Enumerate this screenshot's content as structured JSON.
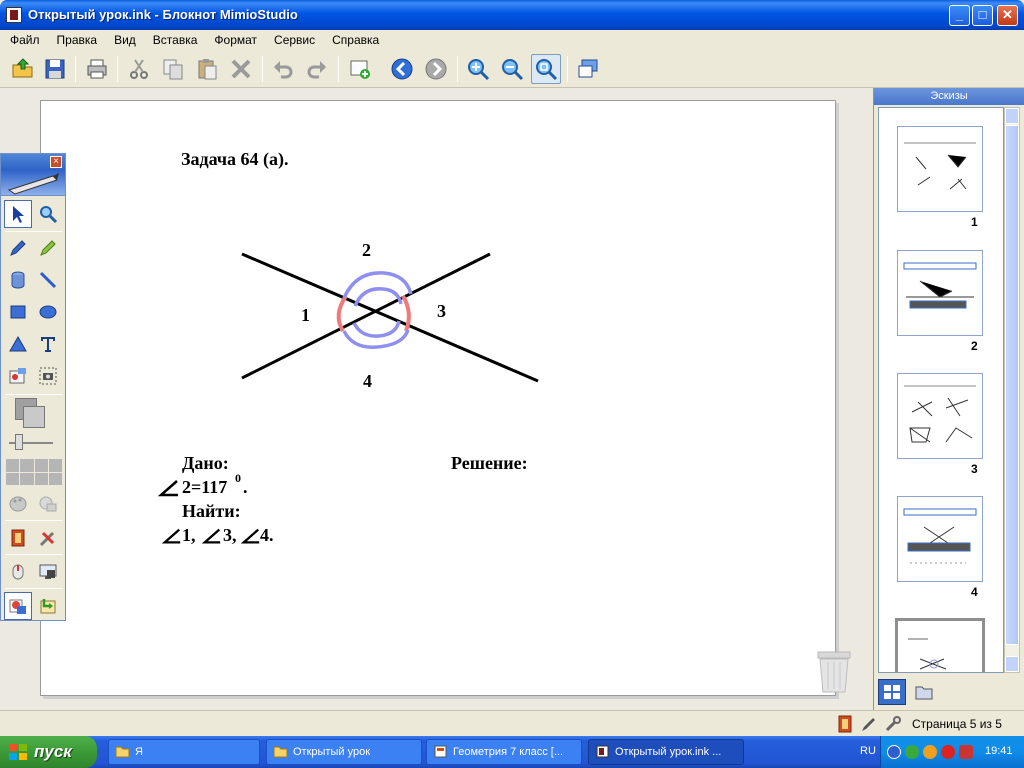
{
  "window": {
    "title": "Открытый урок.ink - Блокнот MimioStudio"
  },
  "menu": [
    "Файл",
    "Правка",
    "Вид",
    "Вставка",
    "Формат",
    "Сервис",
    "Справка"
  ],
  "toolbar": {
    "icons": [
      "open-icon",
      "save-icon",
      "print-icon",
      "cut-icon",
      "copy-icon",
      "paste-icon",
      "delete-icon",
      "undo-icon",
      "redo-icon",
      "new-page-icon",
      "back-icon",
      "forward-icon",
      "zoom-in-icon",
      "zoom-out-icon",
      "zoom-fit-icon",
      "screen-view-icon"
    ]
  },
  "slide": {
    "title": "Задача 64 (а).",
    "angle_labels": {
      "a1": "1",
      "a2": "2",
      "a3": "3",
      "a4": "4"
    },
    "given_heading": "Дано:",
    "given_value": "2=117",
    "given_degree": "0",
    "given_dot": ".",
    "find_heading": "Найти:",
    "find_items": [
      "1,",
      "3,",
      " 4."
    ],
    "solution_heading": "Решение:",
    "colors": {
      "line": "#000000",
      "arc_red": "#f07a7a",
      "arc_blue": "#8f8ff0"
    }
  },
  "thumbnails": {
    "header": "Эскизы",
    "pages": [
      "1",
      "2",
      "3",
      "4"
    ]
  },
  "status": {
    "page_info": "Страница 5 из 5"
  },
  "taskbar": {
    "start_label": "пуск",
    "tasks": [
      "Я",
      "Открытый урок",
      "Геометрия 7 класс [...",
      "Открытый урок.ink ..."
    ],
    "language": "RU",
    "clock": "19:41"
  }
}
